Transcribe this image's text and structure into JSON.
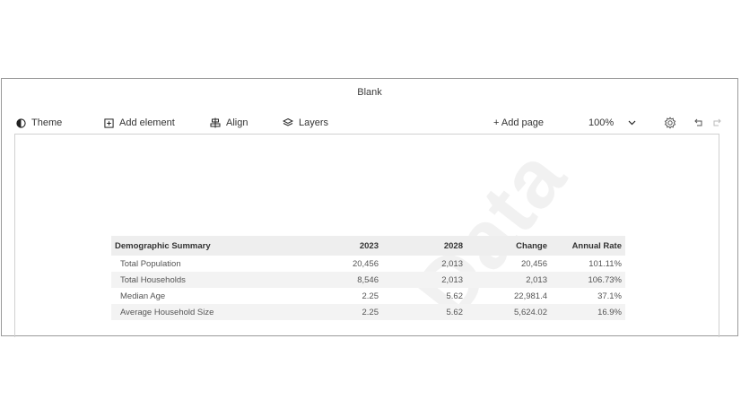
{
  "window": {
    "title": "Blank"
  },
  "toolbar": {
    "theme_label": "Theme",
    "add_element_label": "Add element",
    "align_label": "Align",
    "layers_label": "Layers",
    "add_page_label": "+ Add page",
    "zoom": "100%"
  },
  "watermark": "Data",
  "table": {
    "headers": [
      "Demographic Summary",
      "2023",
      "2028",
      "Change",
      "Annual Rate"
    ],
    "rows": [
      [
        "Total Population",
        "20,456",
        "2,013",
        "20,456",
        "101.11%"
      ],
      [
        "Total Households",
        "8,546",
        "2,013",
        "2,013",
        "106.73%"
      ],
      [
        "Median Age",
        "2.25",
        "5.62",
        "22,981.4",
        "37.1%"
      ],
      [
        "Average Household Size",
        "2.25",
        "5.62",
        "5,624.02",
        "16.9%"
      ]
    ]
  },
  "colors": {
    "header_bg": "#eeeeee",
    "alt_row_bg": "#f3f3f3",
    "border": "#9a9a9a"
  }
}
